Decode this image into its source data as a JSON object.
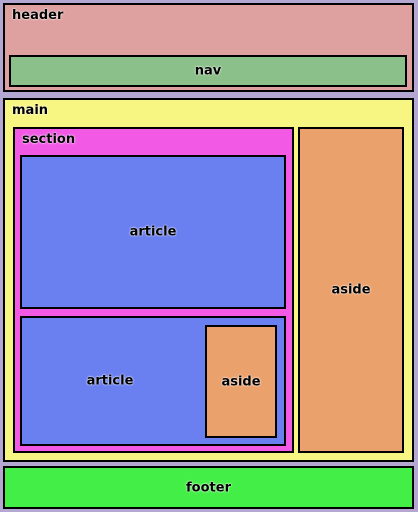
{
  "header": {
    "label": "header"
  },
  "nav": {
    "label": "nav"
  },
  "main": {
    "label": "main"
  },
  "section": {
    "label": "section"
  },
  "article_top": {
    "label": "article"
  },
  "article_bottom": {
    "label": "article"
  },
  "aside_inner": {
    "label": "aside"
  },
  "aside_main": {
    "label": "aside"
  },
  "footer": {
    "label": "footer"
  },
  "colors": {
    "background": "#b4a8d2",
    "header": "#dfa0a0",
    "nav": "#8cc08a",
    "main": "#f8f683",
    "section": "#f25ae6",
    "article": "#6a7ff0",
    "aside": "#eba16c",
    "footer": "#43ef47"
  }
}
